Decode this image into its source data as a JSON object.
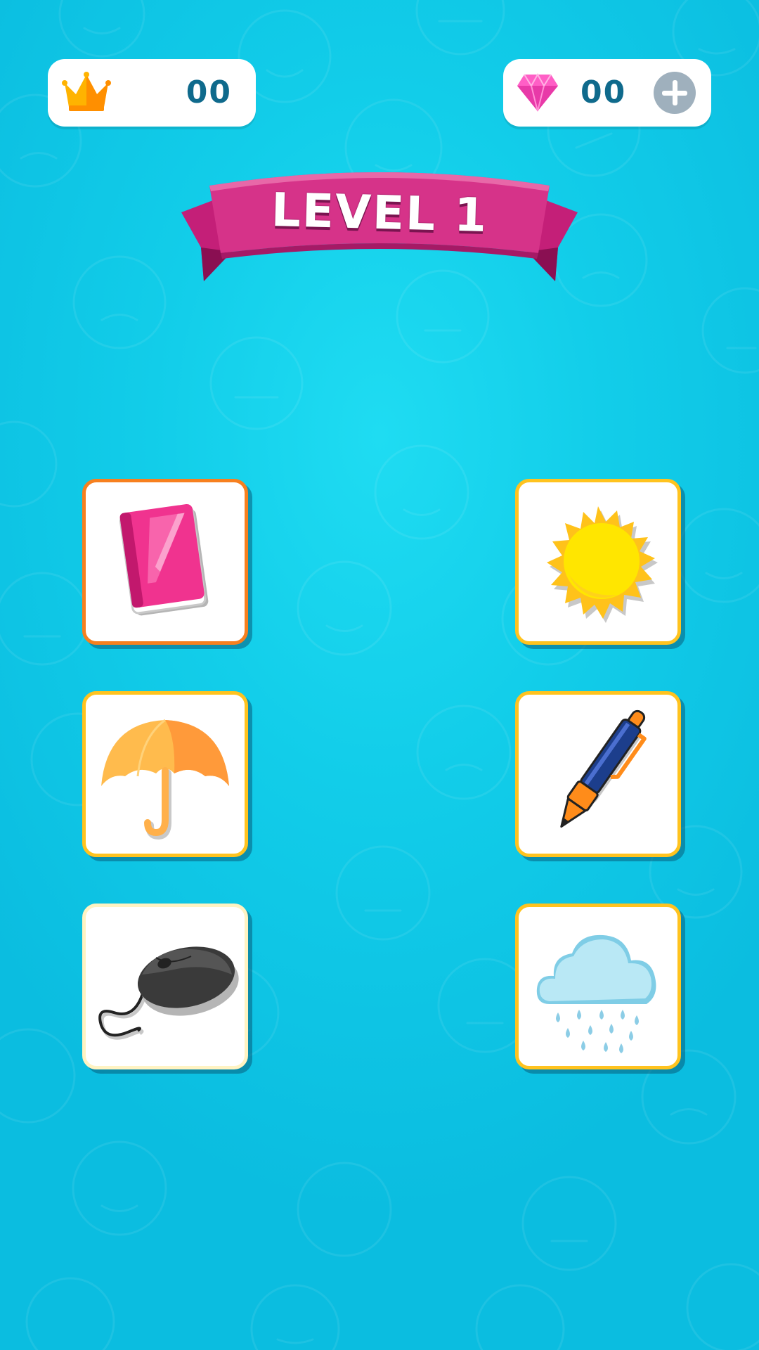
{
  "counters": {
    "crowns": {
      "icon": "crown-icon",
      "value": "00"
    },
    "gems": {
      "icon": "gem-icon",
      "value": "00",
      "add_icon": "plus-icon"
    }
  },
  "banner": {
    "text": "LEVEL 1",
    "color": "#d63389"
  },
  "cards": {
    "left": [
      {
        "icon": "book-icon",
        "state": "selected",
        "border_color": "#f7801f"
      },
      {
        "icon": "umbrella-icon",
        "state": "default",
        "border_color": "#ffc31f"
      },
      {
        "icon": "computer-mouse-icon",
        "state": "default",
        "border_color": "#fff3c2"
      }
    ],
    "right": [
      {
        "icon": "sun-icon",
        "state": "default",
        "border_color": "#ffc31f"
      },
      {
        "icon": "pen-icon",
        "state": "default",
        "border_color": "#ffc31f"
      },
      {
        "icon": "rain-cloud-icon",
        "state": "default",
        "border_color": "#ffc31f"
      }
    ]
  },
  "colors": {
    "background": "#12cde9",
    "counter_text": "#0f6a8c",
    "card_shadow": "#075f7d"
  }
}
